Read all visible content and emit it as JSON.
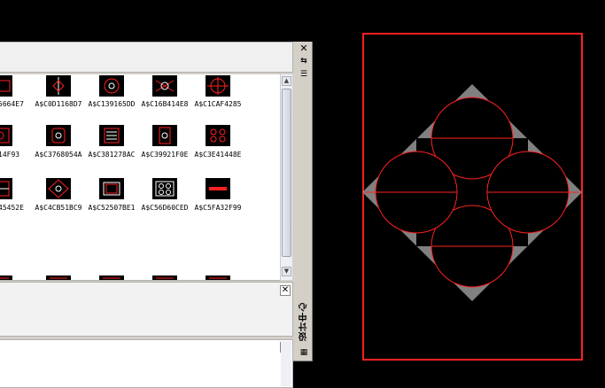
{
  "palette": {
    "title": "设计中心",
    "close_glyph": "✕",
    "pane_close_glyph": "✕",
    "blocks": [
      {
        "label": "5664E7",
        "row": 0,
        "col": 0
      },
      {
        "label": "A$C0D1168D7",
        "row": 0,
        "col": 1
      },
      {
        "label": "A$C139165DD",
        "row": 0,
        "col": 2
      },
      {
        "label": "A$C16B414E8",
        "row": 0,
        "col": 3
      },
      {
        "label": "A$C1CAF4285",
        "row": 0,
        "col": 4
      },
      {
        "label": "14F93",
        "row": 1,
        "col": 0
      },
      {
        "label": "A$C3768054A",
        "row": 1,
        "col": 1
      },
      {
        "label": "A$C381278AC",
        "row": 1,
        "col": 2
      },
      {
        "label": "A$C39921F0E",
        "row": 1,
        "col": 3
      },
      {
        "label": "A$C3E41448E",
        "row": 1,
        "col": 4
      },
      {
        "label": "45452E",
        "row": 2,
        "col": 0
      },
      {
        "label": "A$C4CB51BC9",
        "row": 2,
        "col": 1
      },
      {
        "label": "A$C52507BE1",
        "row": 2,
        "col": 2
      },
      {
        "label": "A$C56D60CED",
        "row": 2,
        "col": 3
      },
      {
        "label": "A$C5FA32F99",
        "row": 2,
        "col": 4
      }
    ]
  },
  "colors": {
    "accent": "#ff2020",
    "shape_fill": "#808080",
    "background": "#000000"
  }
}
